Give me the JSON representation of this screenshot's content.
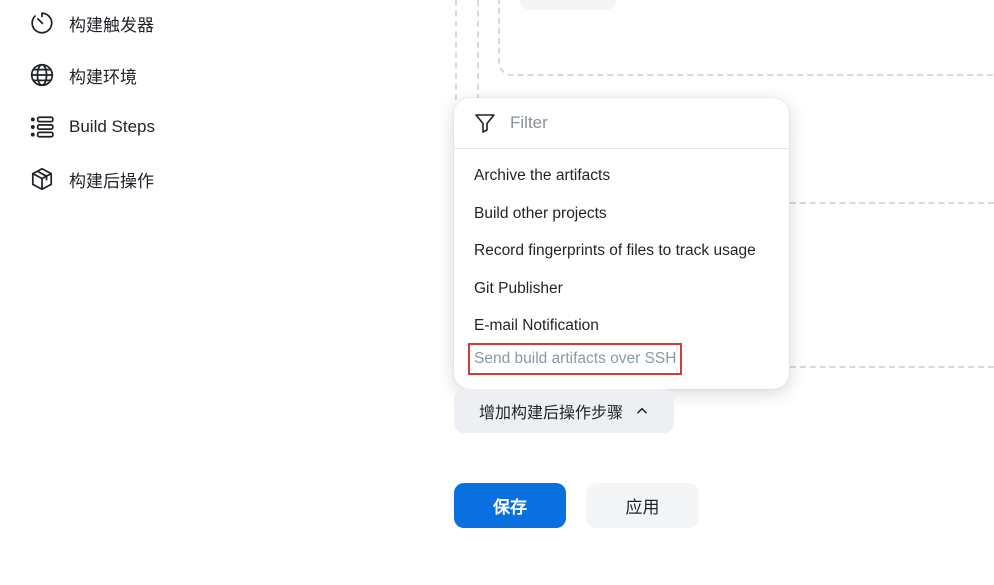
{
  "sidebar": {
    "items": [
      {
        "label": "构建触发器",
        "icon": "timer-icon"
      },
      {
        "label": "构建环境",
        "icon": "globe-icon"
      },
      {
        "label": "Build Steps",
        "icon": "list-icon"
      },
      {
        "label": "构建后操作",
        "icon": "package-icon"
      }
    ]
  },
  "dropdown": {
    "filter_placeholder": "Filter",
    "items": [
      {
        "label": "Archive the artifacts"
      },
      {
        "label": "Build other projects"
      },
      {
        "label": "Record fingerprints of files to track usage"
      },
      {
        "label": "Git Publisher"
      },
      {
        "label": "E-mail Notification"
      },
      {
        "label": "Send build artifacts over SSH",
        "highlighted": true
      }
    ]
  },
  "actions": {
    "add_post_build_step_label": "增加构建后操作步骤",
    "save_label": "保存",
    "apply_label": "应用"
  },
  "colors": {
    "primary": "#0a6fdf",
    "highlight_border": "#d33a3a",
    "dashed": "#d6d9de"
  }
}
